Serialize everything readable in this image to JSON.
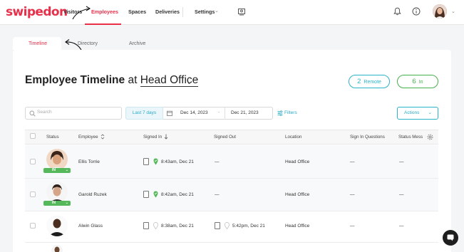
{
  "brand": {
    "logo": "swipedon",
    "accent": "#e8304a"
  },
  "nav": {
    "items": [
      {
        "label": "Visitors",
        "active": false
      },
      {
        "label": "Employees",
        "active": true
      },
      {
        "label": "Spaces",
        "active": false
      },
      {
        "label": "Deliveries",
        "active": false
      },
      {
        "label": "Settings",
        "active": false
      }
    ],
    "icons": [
      "kiosk-icon",
      "bell-icon",
      "info-icon",
      "avatar"
    ]
  },
  "subtabs": [
    "Timeline",
    "Directory",
    "Archive"
  ],
  "header": {
    "title_bold": "Employee Timeline",
    "title_connector": "at",
    "location": "Head Office",
    "remote_count": "2",
    "remote_label": "Remote",
    "in_count": "6",
    "in_label": "In"
  },
  "toolbar": {
    "search_placeholder": "Search",
    "range_label": "Last 7 days",
    "date_from": "Dec 14, 2023",
    "date_sep": "-",
    "date_to": "Dec 21, 2023",
    "filters_label": "Filters",
    "actions_label": "Actions"
  },
  "table": {
    "headers": [
      "Status",
      "Employee",
      "Signed In",
      "Signed Out",
      "Location",
      "Sign In Questions",
      "Status Mess"
    ],
    "rows": [
      {
        "status": "IN",
        "name": "Ellis Torrie",
        "signed_in": "8:43am, Dec 21",
        "signed_out": "—",
        "location": "Head Office",
        "questions": "—",
        "status_message": "—"
      },
      {
        "status": "IN",
        "name": "Garold Ruzek",
        "signed_in": "8:42am, Dec 21",
        "signed_out": "—",
        "location": "Head Office",
        "questions": "—",
        "status_message": "—"
      },
      {
        "status": "",
        "name": "Alwin Glass",
        "signed_in": "8:38am, Dec 21",
        "signed_out": "5:42pm, Dec 21",
        "location": "Head Office",
        "questions": "—",
        "status_message": "—"
      }
    ]
  },
  "colors": {
    "teal": "#2bb3c9",
    "green": "#46b04a",
    "status_green": "#55b85a"
  }
}
